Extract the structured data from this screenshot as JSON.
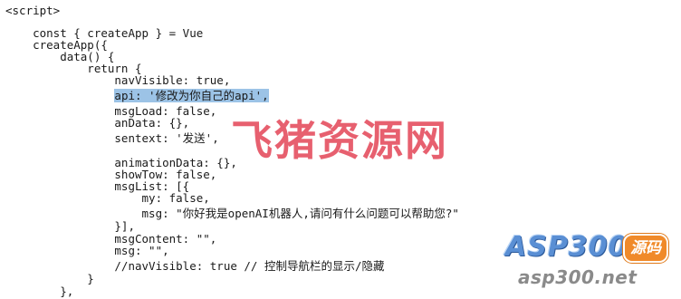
{
  "code": {
    "lines": [
      "<script>",
      "",
      "    const { createApp } = Vue",
      "    createApp({",
      "        data() {",
      "            return {",
      "                navVisible: true,",
      "                api: '修改为你自己的api',",
      "                msgLoad: false,",
      "                anData: {},",
      "                sentext: '发送',",
      "",
      "                animationData: {},",
      "                showTow: false,",
      "                msgList: [{",
      "                    my: false,",
      "                    msg: \"你好我是openAI机器人,请问有什么问题可以帮助您?\"",
      "                }],",
      "                msgContent: \"\",",
      "                msg: \"\",",
      "                //navVisible: true // 控制导航栏的显示/隐藏",
      "            }",
      "        },"
    ],
    "selected_line": 7
  },
  "watermark": {
    "text": "飞猪资源网",
    "color": "#e34456"
  },
  "logo": {
    "brand": "ASP300",
    "badge": "源码",
    "url": "asp300.net",
    "brand_color": "#5a8fd4",
    "badge_color": "#f08a2a"
  }
}
